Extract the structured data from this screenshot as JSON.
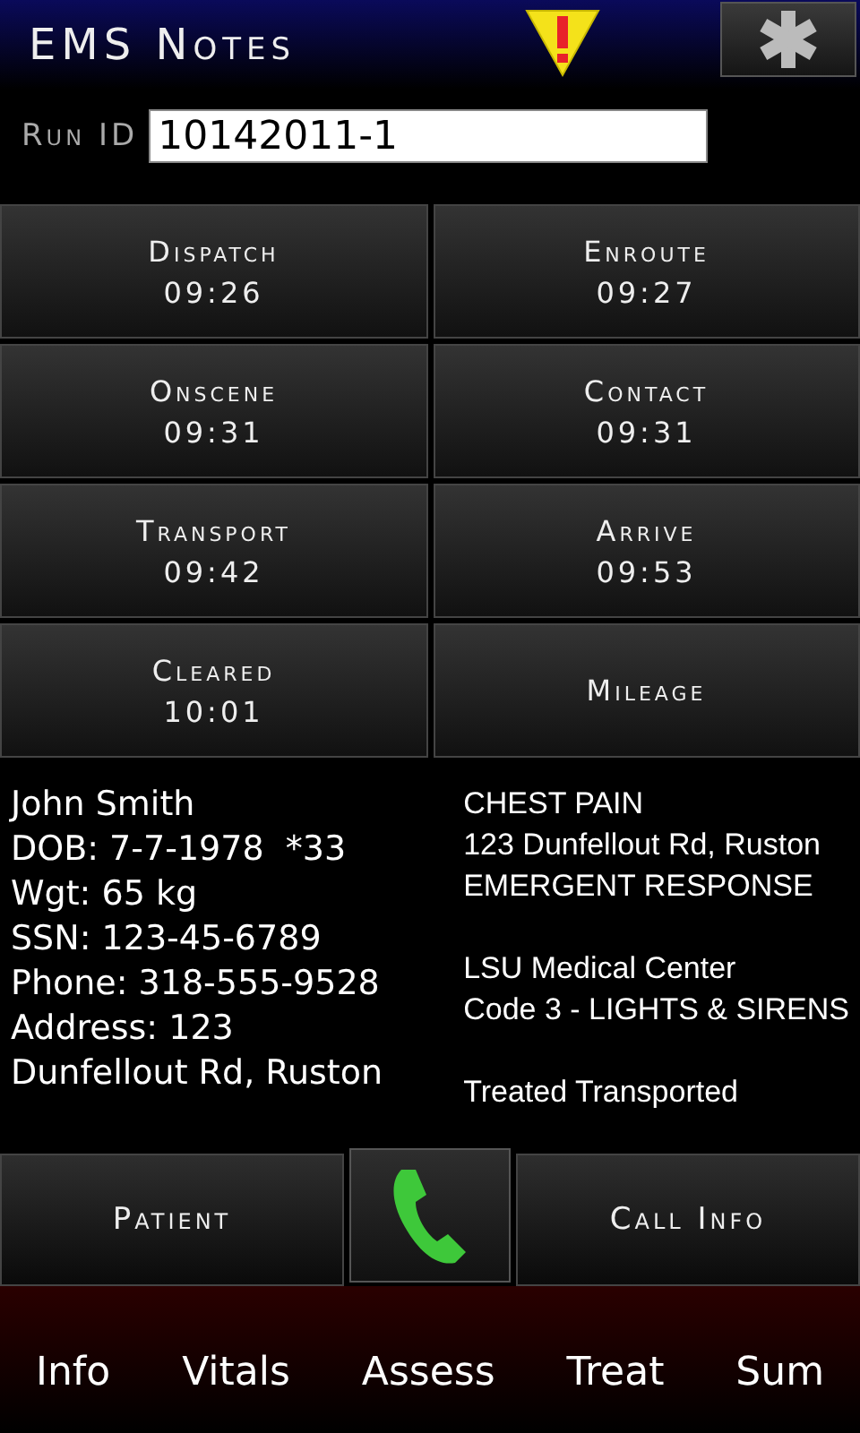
{
  "header": {
    "title": "EMS Notes"
  },
  "run_id": {
    "label": "Run ID",
    "value": "10142011-1"
  },
  "times": [
    {
      "label": "Dispatch",
      "time": "09:26"
    },
    {
      "label": "Enroute",
      "time": "09:27"
    },
    {
      "label": "Onscene",
      "time": "09:31"
    },
    {
      "label": "Contact",
      "time": "09:31"
    },
    {
      "label": "Transport",
      "time": "09:42"
    },
    {
      "label": "Arrive",
      "time": "09:53"
    },
    {
      "label": "Cleared",
      "time": "10:01"
    },
    {
      "label": "Mileage"
    }
  ],
  "patient": [
    "John Smith",
    "DOB: 7-7-1978  *33",
    "Wgt: 65 kg",
    "SSN: 123-45-6789",
    "Phone: 318-555-9528",
    "Address: 123",
    "Dunfellout Rd, Ruston"
  ],
  "call_info": [
    [
      "CHEST PAIN",
      "123 Dunfellout Rd, Ruston",
      "EMERGENT RESPONSE"
    ],
    [
      "LSU Medical Center",
      "Code 3 - LIGHTS & SIRENS"
    ],
    [
      "Treated Transported"
    ]
  ],
  "actions": {
    "left": "Patient",
    "right": "Call Info"
  },
  "tabs": [
    "Info",
    "Vitals",
    "Assess",
    "Treat",
    "Sum"
  ]
}
